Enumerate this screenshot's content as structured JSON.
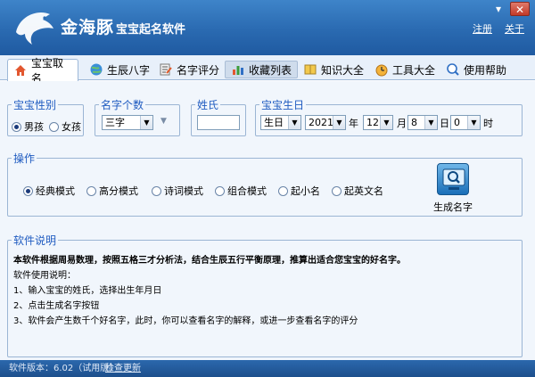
{
  "header": {
    "brand_big": "金海豚",
    "brand_small": "宝宝起名软件",
    "link_register": "注册",
    "link_about": "关于",
    "minimize_glyph": "▾",
    "close_glyph": "✕"
  },
  "tabs": [
    {
      "label": "宝宝取名",
      "icon": "home-icon",
      "active": true
    },
    {
      "label": "生辰八字",
      "icon": "globe-icon"
    },
    {
      "label": "名字评分",
      "icon": "score-icon"
    },
    {
      "label": "收藏列表",
      "icon": "favorites-icon",
      "highlighted": true
    },
    {
      "label": "知识大全",
      "icon": "book-icon"
    },
    {
      "label": "工具大全",
      "icon": "clock-icon"
    },
    {
      "label": "使用帮助",
      "icon": "help-icon"
    }
  ],
  "gender": {
    "legend": "宝宝性别",
    "options": [
      "男孩",
      "女孩"
    ],
    "selected": "男孩"
  },
  "name_count": {
    "legend": "名字个数",
    "selected": "三字",
    "arrow": "▼"
  },
  "surname": {
    "legend": "姓氏",
    "value": ""
  },
  "birthday": {
    "legend": "宝宝生日",
    "calendar": "生日",
    "year": "2021",
    "year_unit": "年",
    "month": "12",
    "month_unit": "月",
    "day": "8",
    "day_unit": "日",
    "hour": "0",
    "hour_unit": "时"
  },
  "operation": {
    "legend": "操作",
    "modes": [
      "经典模式",
      "高分模式",
      "诗词模式",
      "组合模式",
      "起小名",
      "起英文名"
    ],
    "selected": "经典模式",
    "generate_label": "生成名字"
  },
  "description": {
    "legend": "软件说明",
    "intro": "本软件根据周易数理，按照五格三才分析法，结合生辰五行平衡原理，推算出适合您宝宝的好名字。",
    "usage_title": "软件使用说明：",
    "steps": [
      "1、输入宝宝的姓氏，选择出生年月日",
      "2、点击生成名字按钮",
      "3、软件会产生数千个好名字，此时，你可以查看名字的解释，或进一步查看名字的评分"
    ]
  },
  "status": {
    "version": "软件版本：6.02（试用版）",
    "update_link": "检查更新"
  }
}
